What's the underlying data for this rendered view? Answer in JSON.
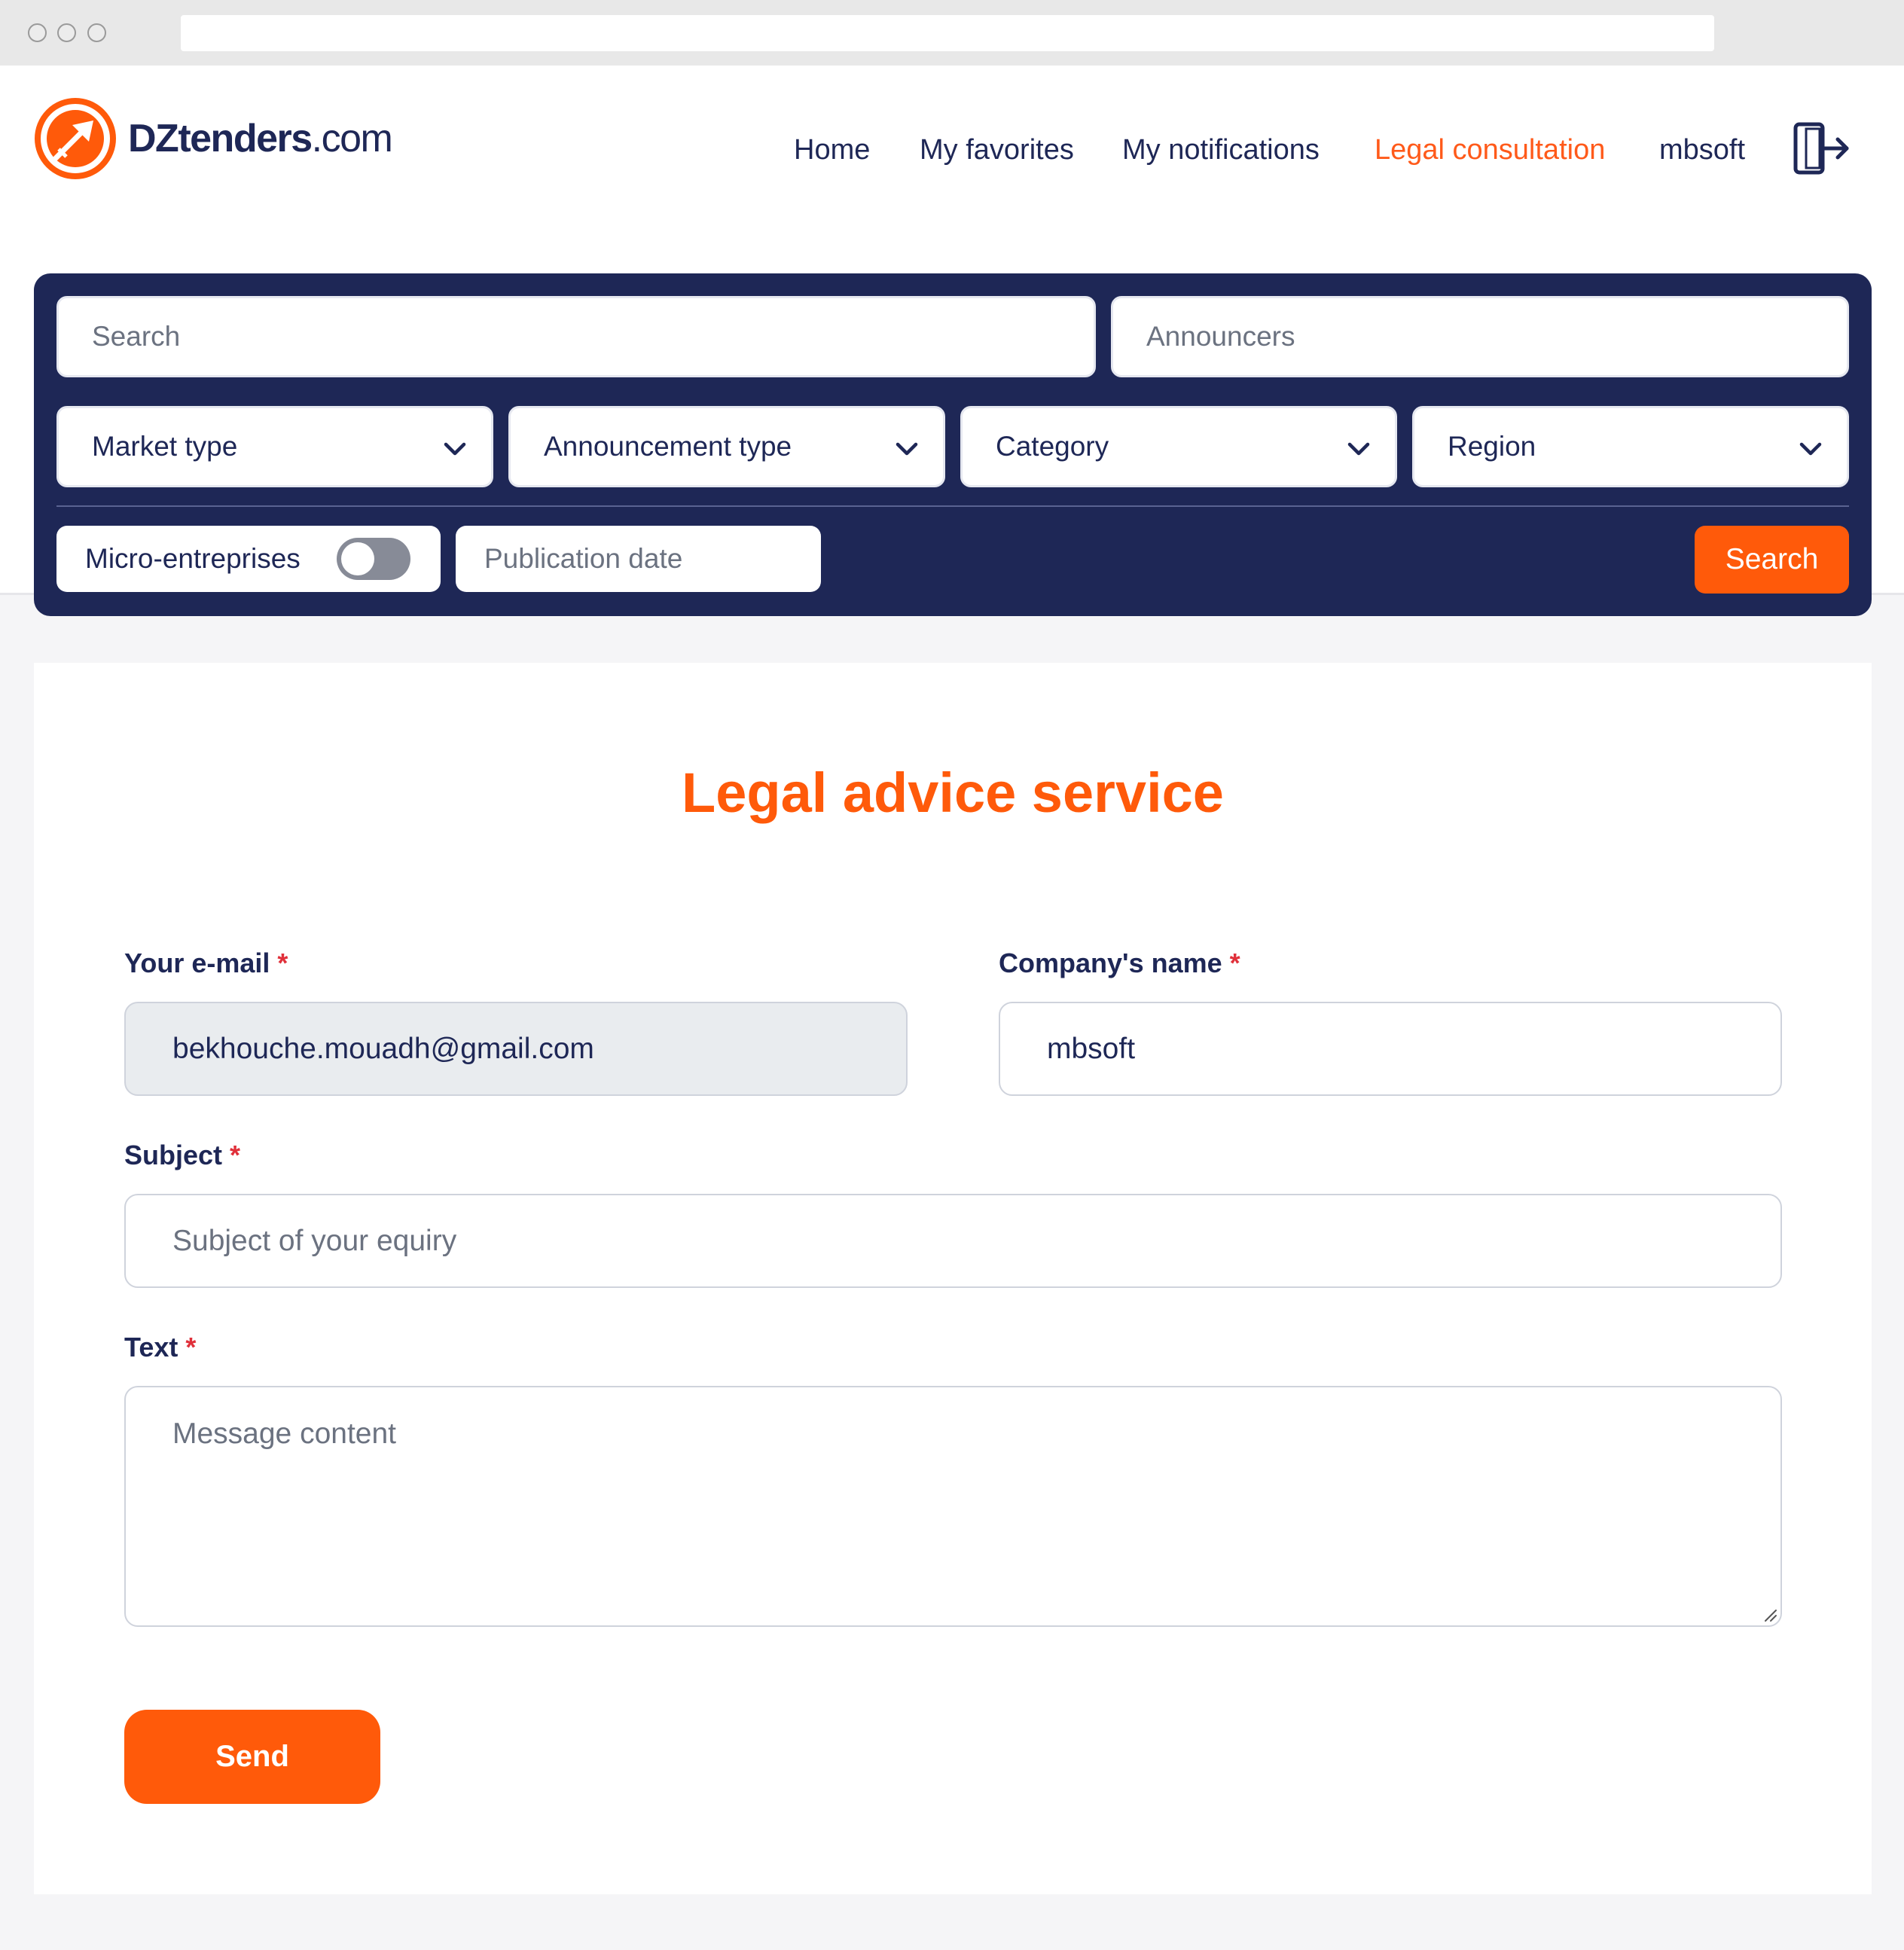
{
  "brand": {
    "name_main": "DZtenders",
    "name_suffix": ".com"
  },
  "nav": {
    "items": [
      {
        "label": "Home"
      },
      {
        "label": "My favorites"
      },
      {
        "label": "My notifications"
      },
      {
        "label": "Legal consultation",
        "active": true
      },
      {
        "label": "mbsoft"
      }
    ]
  },
  "search_panel": {
    "search_placeholder": "Search",
    "announcers_placeholder": "Announcers",
    "selects": [
      {
        "label": "Market type"
      },
      {
        "label": "Announcement type"
      },
      {
        "label": "Category"
      },
      {
        "label": "Region"
      }
    ],
    "micro_label": "Micro-entreprises",
    "micro_enabled": false,
    "pubdate_placeholder": "Publication date",
    "search_button": "Search"
  },
  "form": {
    "title": "Legal advice service",
    "email_label": "Your e-mail",
    "email_value": "bekhouche.mouadh@gmail.com",
    "company_label": "Company's name",
    "company_value": "mbsoft",
    "subject_label": "Subject",
    "subject_placeholder": "Subject of your equiry",
    "text_label": "Text",
    "text_placeholder": "Message content",
    "required_mark": "*",
    "send_button": "Send"
  },
  "colors": {
    "accent": "#ff5a0a",
    "navy": "#1e2756",
    "required": "#e0303a"
  },
  "icons": {
    "logo": "compass-arrow-logo-icon",
    "logout": "logout-door-icon",
    "chevron": "chevron-down-icon"
  }
}
